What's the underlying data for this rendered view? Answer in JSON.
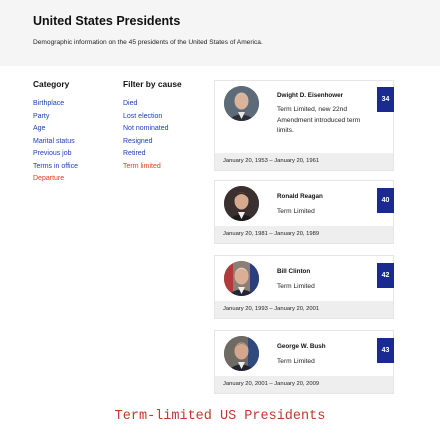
{
  "page": {
    "title": "United States Presidents",
    "description": "Demographic information on the 45 presidents of the United States of America."
  },
  "category": {
    "heading": "Category",
    "items": [
      "Birthplace",
      "Party",
      "Age",
      "Marital status",
      "Previous job",
      "Terms in office",
      "Departure"
    ],
    "active": "Departure"
  },
  "filter": {
    "heading": "Filter by cause",
    "items": [
      "Died",
      "Lost election",
      "Not nominated",
      "Resigned",
      "Retired",
      "Term limited"
    ],
    "active": "Term limited"
  },
  "presidents": [
    {
      "name": "Dwight D. Eisenhower",
      "status": "Term Limited, new 22nd Amendment introduced term limits.",
      "number": "34",
      "term": "January 20, 1953 – January 20, 1961",
      "photo": "eisenhower-portrait"
    },
    {
      "name": "Ronald Reagan",
      "status": "Term Limited",
      "number": "40",
      "term": "January 20, 1981 – January 20, 1989",
      "photo": "reagan-portrait"
    },
    {
      "name": "Bill Clinton",
      "status": "Term Limited",
      "number": "42",
      "term": "January 20, 1993 – January 20, 2001",
      "photo": "clinton-portrait"
    },
    {
      "name": "George W. Bush",
      "status": "Term Limited",
      "number": "43",
      "term": "January 20, 2001 – January 20, 2009",
      "photo": "bush-portrait"
    }
  ],
  "caption": "Term-limited US Presidents",
  "colors": {
    "link": "#1c3fb7",
    "active": "#e0401e",
    "badge": "#1b2a8f",
    "caption": "#c0392b"
  }
}
